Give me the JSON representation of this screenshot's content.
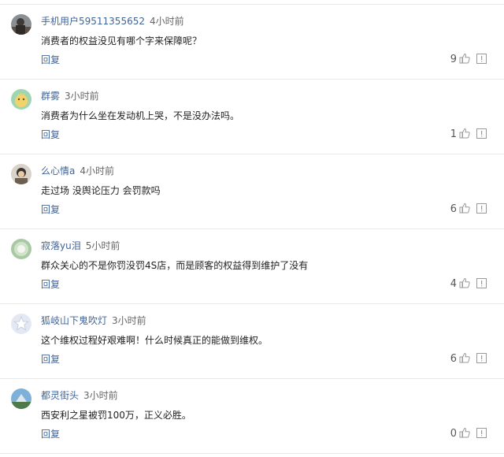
{
  "comments": [
    {
      "username": "手机用户59511355652",
      "time": "4小时前",
      "text": "消费者的权益没见有哪个字来保障呢？",
      "reply_label": "回复",
      "likes": "9",
      "avatar": "avatar-photo-icon"
    },
    {
      "username": "群雾",
      "time": "3小时前",
      "text": "消费者为什么坐在发动机上哭，不是没办法吗。",
      "reply_label": "回复",
      "likes": "1",
      "avatar": "avatar-cartoon-icon"
    },
    {
      "username": "么心情a",
      "time": "4小时前",
      "text": "走过场 没舆论压力 会罚款吗",
      "reply_label": "回复",
      "likes": "6",
      "avatar": "avatar-photo-icon"
    },
    {
      "username": "寂落yu泪",
      "time": "5小时前",
      "text": "群众关心的不是你罚没罚4S店，而是顾客的权益得到维护了没有",
      "reply_label": "回复",
      "likes": "4",
      "avatar": "avatar-photo-icon"
    },
    {
      "username": "狐岐山下鬼吹灯",
      "time": "3小时前",
      "text": "这个维权过程好艰难啊！什么时候真正的能做到维权。",
      "reply_label": "回复",
      "likes": "6",
      "avatar": "avatar-default-star-icon"
    },
    {
      "username": "都灵街头",
      "time": "3小时前",
      "text": "西安利之星被罚100万，正义必胜。",
      "reply_label": "回复",
      "likes": "0",
      "avatar": "avatar-photo-icon"
    }
  ],
  "colors": {
    "link": "#406599",
    "text": "#222222",
    "meta": "#666666",
    "divider": "#e9e9e9"
  }
}
